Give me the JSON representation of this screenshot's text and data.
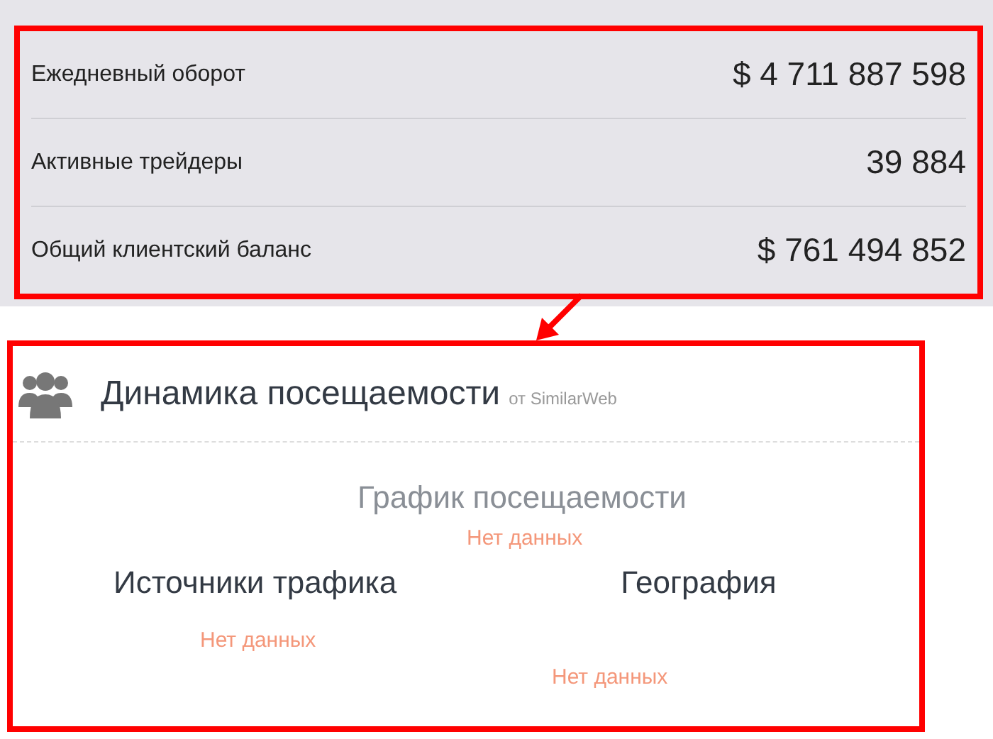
{
  "stats": [
    {
      "label": "Ежедневный оборот",
      "value": "$ 4 711 887 598"
    },
    {
      "label": "Активные трейдеры",
      "value": "39 884"
    },
    {
      "label": "Общий клиентский баланс",
      "value": "$ 761 494 852"
    }
  ],
  "traffic": {
    "title": "Динамика посещаемости",
    "source": "от SimilarWeb",
    "sections": [
      {
        "title": "График посещаемости",
        "empty_text": "Нет данных"
      },
      {
        "title": "Источники трафика",
        "empty_text": "Нет данных"
      },
      {
        "title": "География",
        "empty_text": "Нет данных"
      }
    ]
  }
}
